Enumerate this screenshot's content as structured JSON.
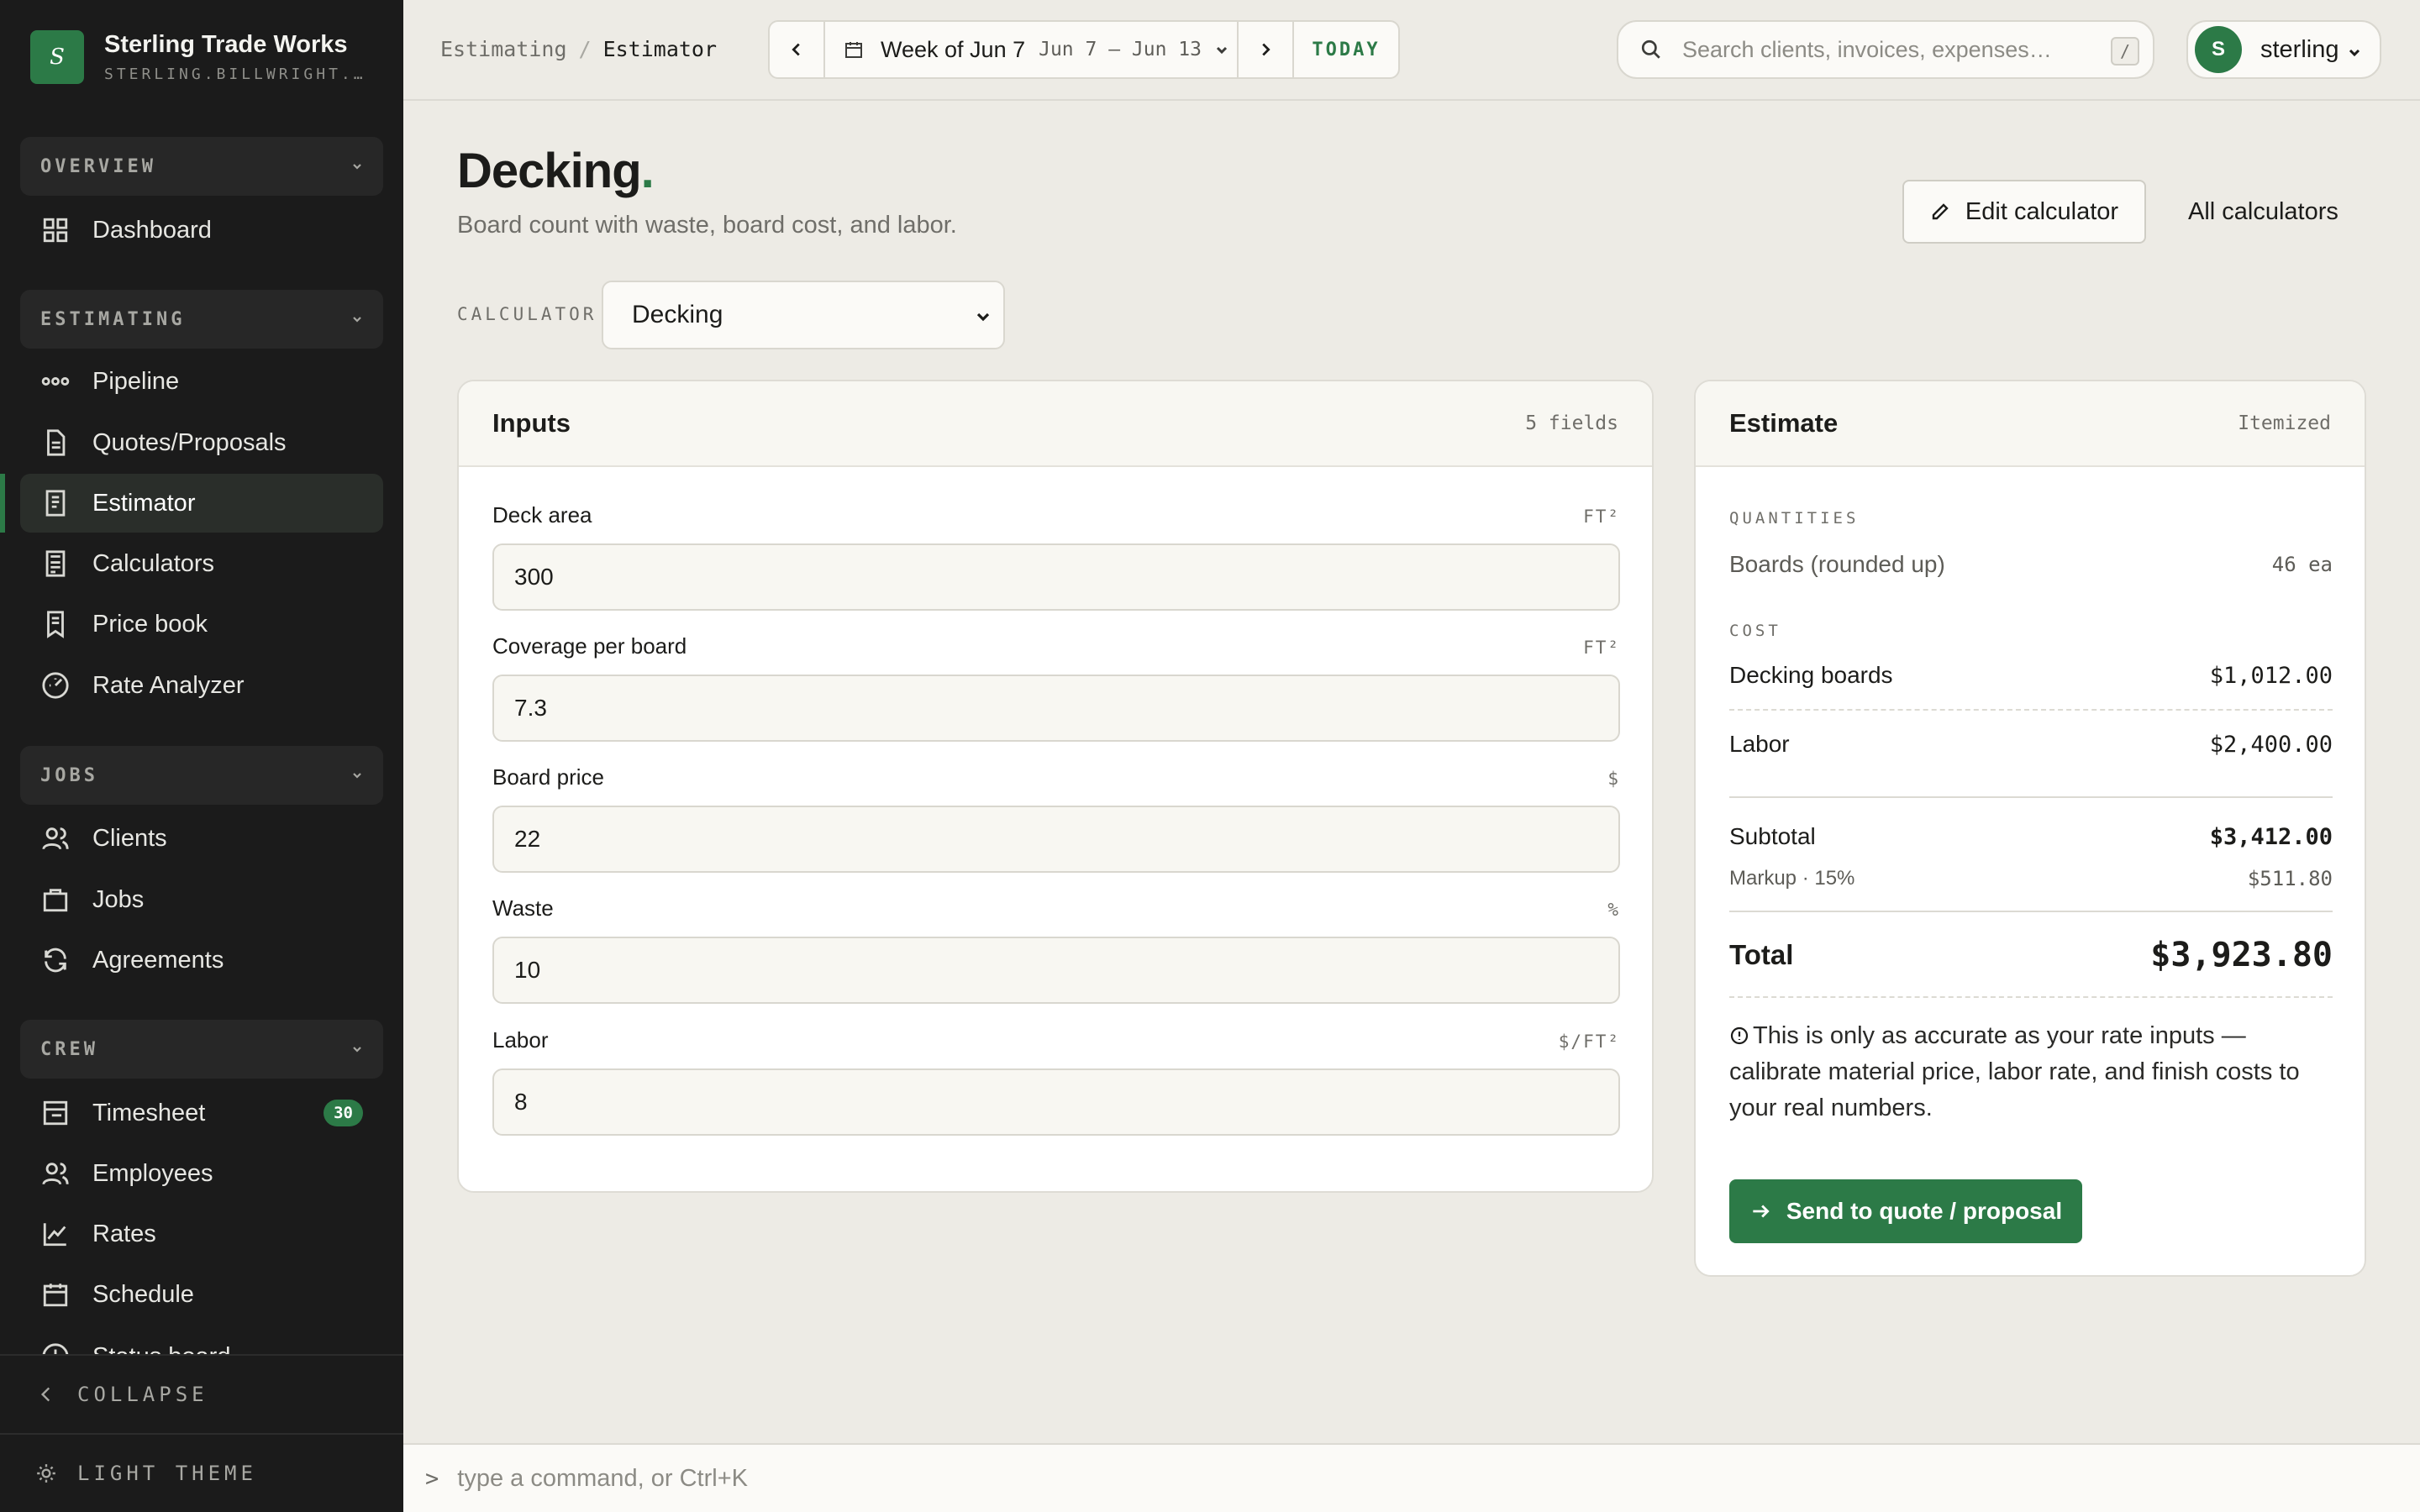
{
  "brand": {
    "logo_letter": "S",
    "name": "Sterling Trade Works",
    "domain": "STERLING.BILLWRIGHT.APP"
  },
  "sidebar": {
    "sections": {
      "overview": "OVERVIEW",
      "estimating": "ESTIMATING",
      "jobs": "JOBS",
      "crew": "CREW"
    },
    "items": {
      "dashboard": "Dashboard",
      "pipeline": "Pipeline",
      "quotes": "Quotes/Proposals",
      "estimator": "Estimator",
      "calculators": "Calculators",
      "price_book": "Price book",
      "rate_analyzer": "Rate Analyzer",
      "clients": "Clients",
      "jobs": "Jobs",
      "agreements": "Agreements",
      "timesheet": "Timesheet",
      "timesheet_badge": "30",
      "employees": "Employees",
      "rates": "Rates",
      "schedule": "Schedule",
      "status_board": "Status board"
    },
    "collapse_label": "COLLAPSE",
    "theme_label": "LIGHT THEME"
  },
  "topbar": {
    "breadcrumb": [
      "Estimating",
      "Estimator"
    ],
    "week_label": "Week of Jun 7",
    "week_dates": "Jun 7 – Jun 13",
    "today_label": "TODAY",
    "search_placeholder": "Search clients, invoices, expenses…",
    "search_shortcut": "/",
    "user_initial": "S",
    "user_name": "sterling"
  },
  "page": {
    "title": "Decking",
    "title_dot": ".",
    "subtitle": "Board count with waste, board cost, and labor.",
    "edit_button": "Edit calculator",
    "all_calculators": "All calculators",
    "calculator_label": "CALCULATOR",
    "calculator_selected": "Decking"
  },
  "inputs": {
    "title": "Inputs",
    "meta": "5 fields",
    "fields": [
      {
        "label": "Deck area",
        "unit": "FT²",
        "value": "300"
      },
      {
        "label": "Coverage per board",
        "unit": "FT²",
        "value": "7.3"
      },
      {
        "label": "Board price",
        "unit": "$",
        "value": "22"
      },
      {
        "label": "Waste",
        "unit": "%",
        "value": "10"
      },
      {
        "label": "Labor",
        "unit": "$/FT²",
        "value": "8"
      }
    ]
  },
  "estimate": {
    "title": "Estimate",
    "meta": "Itemized",
    "quantities_caption": "QUANTITIES",
    "boards_label": "Boards (rounded up)",
    "boards_value": "46 ea",
    "cost_caption": "COST",
    "decking_label": "Decking boards",
    "decking_value": "$1,012.00",
    "labor_label": "Labor",
    "labor_value": "$2,400.00",
    "subtotal_label": "Subtotal",
    "subtotal_value": "$3,412.00",
    "markup_label": "Markup · 15%",
    "markup_value": "$511.80",
    "total_label": "Total",
    "total_value": "$3,923.80",
    "note": "This is only as accurate as your rate inputs — calibrate material price, labor rate, and finish costs to your real numbers.",
    "send_button": "Send to quote / proposal"
  },
  "command_bar": {
    "prompt": ">",
    "placeholder": "type a command, or Ctrl+K"
  },
  "colors": {
    "accent": "#2c7a47",
    "sidebar_bg": "#1b1b1b",
    "page_bg": "#edebe5"
  }
}
